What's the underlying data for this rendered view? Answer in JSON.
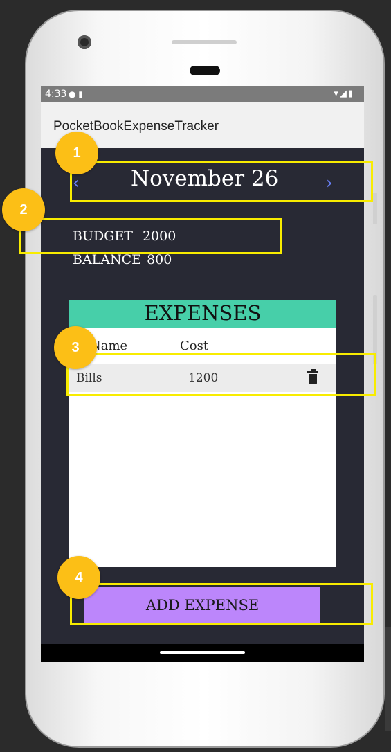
{
  "status_bar": {
    "time": "4:33",
    "left_icons": "● ▮",
    "right_icons": "▾◢▮"
  },
  "app_bar": {
    "title": "PocketBookExpenseTracker"
  },
  "date_nav": {
    "prev_arrow": "‹",
    "date": "November 26",
    "next_arrow": "›"
  },
  "summary": {
    "budget_label": "BUDGET",
    "budget_value": "2000",
    "balance_label": "BALANCE",
    "balance_value": "800"
  },
  "expenses": {
    "heading": "EXPENSES",
    "columns": [
      "Name",
      "Cost"
    ],
    "rows": [
      {
        "name": "Bills",
        "cost": "1200",
        "action_icon": "trash-icon"
      }
    ]
  },
  "actions": {
    "add_expense_label": "ADD EXPENSE"
  },
  "annotations": {
    "badges": [
      "1",
      "2",
      "3",
      "4"
    ],
    "badge_color": "#fcbf16",
    "highlight_color": "#f8ec00"
  },
  "colors": {
    "screen_bg": "#282934",
    "table_header": "#47cfa9",
    "add_button": "#bc86fb",
    "nav_arrow": "#6b83ff"
  }
}
